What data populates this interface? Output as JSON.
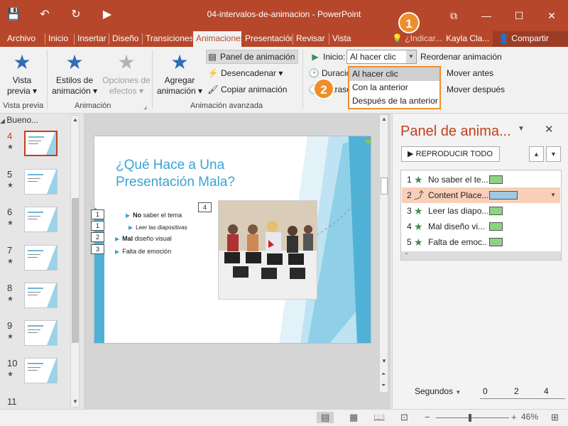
{
  "window": {
    "title": "04-intervalos-de-animacion  -  PowerPoint",
    "qat": [
      "💾",
      "↶",
      "↻",
      "▶"
    ],
    "controls": [
      "⧉",
      "—",
      "☐",
      "✕"
    ]
  },
  "tabs": [
    {
      "label": "Archivo"
    },
    {
      "label": "Inicio"
    },
    {
      "label": "Insertar"
    },
    {
      "label": "Diseño"
    },
    {
      "label": "Transiciones"
    },
    {
      "label": "Animaciones"
    },
    {
      "label": "Presentación"
    },
    {
      "label": "Revisar"
    },
    {
      "label": "Vista"
    }
  ],
  "tellme": "¿Indicar...",
  "user": "Kayla Cla...",
  "share": "Compartir",
  "ribbon": {
    "preview": {
      "label1": "Vista",
      "label2": "previa",
      "group": "Vista previa"
    },
    "effects": {
      "label1": "Estilos de",
      "label2": "animación",
      "group": "Animación"
    },
    "options": {
      "label1": "Opciones de",
      "label2": "efectos"
    },
    "add": {
      "label1": "Agregar",
      "label2": "animación"
    },
    "advanced": {
      "group": "Animación avanzada",
      "pane": "Panel de animación",
      "trigger": "Desencadenar",
      "copy": "Copiar animación"
    },
    "timing": {
      "start_label": "Inicio:",
      "start_value": "Al hacer clic",
      "duration_label": "Duración",
      "delay_label": "Retraso",
      "reorder": "Reordenar animación",
      "move_earlier": "Mover antes",
      "move_later": "Mover después"
    },
    "start_options": [
      "Al hacer clic",
      "Con la anterior",
      "Después de la anterior"
    ]
  },
  "callouts": [
    "1",
    "2"
  ],
  "thumbs": {
    "header": "Bueno...",
    "items": [
      {
        "num": "4",
        "active": true
      },
      {
        "num": "5"
      },
      {
        "num": "6"
      },
      {
        "num": "7"
      },
      {
        "num": "8"
      },
      {
        "num": "9"
      },
      {
        "num": "10"
      },
      {
        "num": "11"
      }
    ]
  },
  "slide": {
    "title": "¿Qué Hace a Una Presentación Mala?",
    "bullets": [
      {
        "bold": "No",
        "text": " saber el tema",
        "tag": "1"
      },
      {
        "bold": "",
        "text": "Leer las diapositivas",
        "tag": "1",
        "sub": true
      },
      {
        "bold": "Mal",
        "text": " diseño visual",
        "tag": "2"
      },
      {
        "bold": "",
        "text": "Falta de emoción",
        "tag": "3"
      }
    ],
    "photo_tag": "4"
  },
  "anim_pane": {
    "title": "Panel de anima...",
    "play": "REPRODUCIR TODO",
    "items": [
      {
        "num": "1",
        "label": "No saber el te...",
        "kind": "star"
      },
      {
        "num": "2",
        "label": "Content Place...",
        "kind": "path",
        "selected": true
      },
      {
        "num": "3",
        "label": "Leer las diapo...",
        "kind": "star"
      },
      {
        "num": "4",
        "label": "Mal diseño vi...",
        "kind": "star"
      },
      {
        "num": "5",
        "label": "Falta de emoc...",
        "kind": "star"
      }
    ],
    "timeline_label": "Segundos",
    "timeline_ticks": [
      "0",
      "2",
      "4"
    ]
  },
  "status": {
    "zoom": "46%"
  },
  "colors": {
    "brand": "#b7472a",
    "accent": "#c43e1c",
    "callout": "#f08e2b",
    "slide_title": "#3aa3d3"
  }
}
